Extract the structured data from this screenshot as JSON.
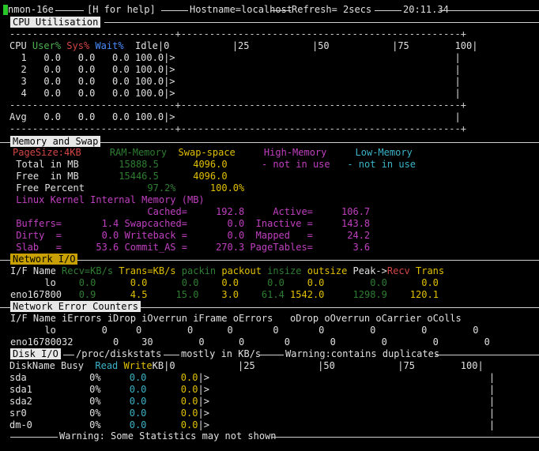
{
  "title_bar": {
    "app": "nmon-16e",
    "help": "[H for help]",
    "hostname": "Hostname=localhost",
    "refresh": "Refresh= 2secs",
    "time": "20:11.34"
  },
  "cpu": {
    "header": "CPU Utilisation",
    "col_cpu": "CPU",
    "col_user": "User%",
    "col_sys": "Sys%",
    "col_wait": "Wait%",
    "col_idle": "Idle|0           |25           |50           |75        100|",
    "rows": [
      "  1   0.0   0.0   0.0 100.0|>                                                 |",
      "  2   0.0   0.0   0.0 100.0|>                                                 |",
      "  3   0.0   0.0   0.0 100.0|>                                                 |",
      "  4   0.0   0.0   0.0 100.0|>                                                 |"
    ],
    "avg": "Avg   0.0   0.0   0.0 100.0|>                                                 |"
  },
  "memory": {
    "header": "Memory and Swap",
    "pagesize": "PageSize:4KB",
    "col_ram": "RAM-Memory",
    "col_swap": "Swap-space",
    "col_high": "High-Memory",
    "col_low": "Low-Memory",
    "total_label": " Total in MB",
    "total_ram": "15888.5",
    "total_swap": "4096.0",
    "total_high": "- not in use",
    "total_low": "- not in use",
    "free_label": " Free  in MB",
    "free_ram": "15446.5",
    "free_swap": "4096.0",
    "pct_label": " Free Percent",
    "pct_ram": "97.2%",
    "pct_swap": "100.0%",
    "kernel_title": " Linux Kernel Internal Memory (MB)",
    "k_row1": "                        Cached=     192.8     Active=     106.7",
    "k_row2": " Buffers=       1.4 Swapcached=       0.0  Inactive =     143.8",
    "k_row3": " Dirty  =       0.0 Writeback =       0.0  Mapped   =      24.2",
    "k_row4": " Slab   =      53.6 Commit_AS =     270.3 PageTables=       3.6"
  },
  "network": {
    "header": "Network I/O",
    "h_ifname": "I/F Name ",
    "h_recv": "Recv=KB/s",
    "h_trans": " Trans=KB/s",
    "h_packin": " packin",
    "h_packout": " packout",
    "h_insize": " insize",
    "h_outsize": " outsize",
    "h_peak": " Peak->",
    "h_precv": "Recv",
    "h_ptrans": " Trans",
    "rows": [
      {
        "name": "      lo",
        "recv": "    0.0",
        "trans": "      0.0",
        "packin": "      0.0",
        "packout": "    0.0",
        "insize": "     0.0",
        "outsize": "    0.0",
        "precv": "        0.0",
        "ptrans": "      0.0"
      },
      {
        "name": "eno167800",
        "recv": "   0.9",
        "trans": "      4.5",
        "packin": "     15.0",
        "packout": "    3.0",
        "insize": "    61.4",
        "outsize": " 1542.0",
        "precv": "     1298.9",
        "ptrans": "    120.1"
      }
    ]
  },
  "net_errors": {
    "header": "Network Error Counters",
    "cols": "I/F Name iErrors iDrop iOverrun iFrame oErrors   oDrop oOverrun oCarrier oColls",
    "rows": [
      "      lo        0     0        0      0       0       0        0        0        0",
      "eno16780032       0    30        0      0       0       0        0        0        0"
    ]
  },
  "disk": {
    "header": "Disk I/O",
    "path": "/proc/diskstats",
    "units": "mostly in KB/s",
    "warning": "Warning:contains duplicates",
    "col_name": "DiskName Busy",
    "col_read": "  Read",
    "col_write": " Write",
    "col_scale": "KB|0           |25           |50           |75        100|",
    "rows": [
      {
        "name": "sda      ",
        "busy": "0%",
        "read": "0.0",
        "write": "0.0"
      },
      {
        "name": "sda1     ",
        "busy": "0%",
        "read": "0.0",
        "write": "0.0"
      },
      {
        "name": "sda2     ",
        "busy": "0%",
        "read": "0.0",
        "write": "0.0"
      },
      {
        "name": "sr0      ",
        "busy": "0%",
        "read": "0.0",
        "write": "0.0"
      },
      {
        "name": "dm-0     ",
        "busy": "0%",
        "read": "0.0",
        "write": "0.0"
      }
    ]
  },
  "footer": {
    "warning": "Warning: Some Statistics may not shown"
  }
}
